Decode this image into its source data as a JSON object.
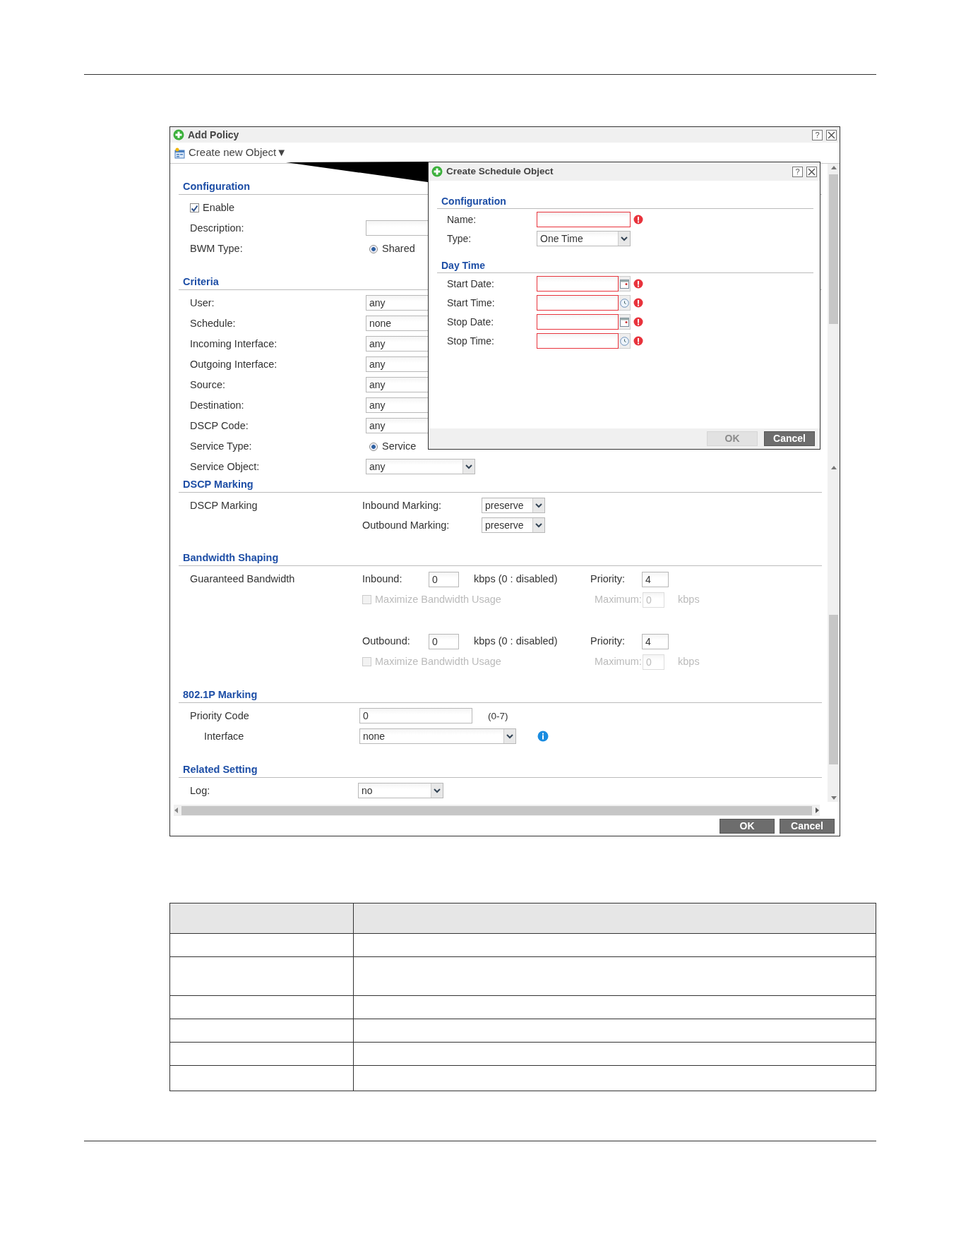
{
  "dialog": {
    "title": "Add Policy",
    "help": "?",
    "toolbar": {
      "label": "Create new Object",
      "caret": "▼"
    },
    "sections": [
      {
        "title": "Configuration",
        "rows": [
          {
            "kind": "checkbox",
            "label": "Enable",
            "checked": true
          },
          {
            "kind": "field",
            "label": "Description:"
          },
          {
            "kind": "radio",
            "label": "BWM Type:",
            "option": "Shared",
            "selected": true
          }
        ]
      },
      {
        "title": "Criteria",
        "rows": [
          {
            "kind": "field",
            "label": "User:",
            "value": "any"
          },
          {
            "kind": "field",
            "label": "Schedule:",
            "value": "none"
          },
          {
            "kind": "field",
            "label": "Incoming Interface:",
            "value": "any"
          },
          {
            "kind": "field",
            "label": "Outgoing Interface:",
            "value": "any"
          },
          {
            "kind": "field",
            "label": "Source:",
            "value": "any"
          },
          {
            "kind": "field",
            "label": "Destination:",
            "value": "any"
          },
          {
            "kind": "field",
            "label": "DSCP Code:",
            "value": "any"
          },
          {
            "kind": "radio",
            "label": "Service Type:",
            "option": "Service",
            "selected": true
          },
          {
            "kind": "select",
            "label": "Service Object:",
            "value": "any"
          }
        ]
      },
      {
        "title": "DSCP Marking",
        "rows": [
          {
            "kind": "marking",
            "label": "DSCP Marking",
            "lines": [
              {
                "label": "Inbound Marking:",
                "value": "preserve"
              },
              {
                "label": "Outbound Marking:",
                "value": "preserve"
              }
            ]
          }
        ]
      },
      {
        "title": "Bandwidth Shaping",
        "rows": [
          {
            "kind": "bandwidth",
            "label": "Guaranteed Bandwidth",
            "directions": [
              {
                "label": "Inbound:",
                "value": "0",
                "unit": "kbps (0 : disabled)",
                "priority_label": "Priority:",
                "priority": "4",
                "maximize": {
                  "label": "Maximize Bandwidth Usage",
                  "checked": false,
                  "disabled": true
                },
                "maximum_label": "Maximum:",
                "maximum": "0",
                "maximum_unit": "kbps"
              },
              {
                "label": "Outbound:",
                "value": "0",
                "unit": "kbps (0 : disabled)",
                "priority_label": "Priority:",
                "priority": "4",
                "maximize": {
                  "label": "Maximize Bandwidth Usage",
                  "checked": false,
                  "disabled": true
                },
                "maximum_label": "Maximum:",
                "maximum": "0",
                "maximum_unit": "kbps"
              }
            ]
          }
        ]
      },
      {
        "title": "802.1P Marking",
        "rows": [
          {
            "kind": "field",
            "label": "Priority Code",
            "value": "0",
            "hint": "(0-7)"
          },
          {
            "kind": "select",
            "label": "Interface",
            "value": "none",
            "indented": true,
            "info": true
          }
        ]
      },
      {
        "title": "Related Setting",
        "rows": [
          {
            "kind": "select",
            "label": "Log:",
            "value": "no"
          }
        ]
      }
    ],
    "buttons": [
      {
        "label": "OK",
        "disabled": false
      },
      {
        "label": "Cancel",
        "disabled": false
      }
    ]
  },
  "schedule_dialog": {
    "title": "Create Schedule Object",
    "help": "?",
    "sections": [
      {
        "title": "Configuration",
        "rows": [
          {
            "kind": "field",
            "label": "Name:",
            "required": true
          },
          {
            "kind": "select",
            "label": "Type:",
            "value": "One Time"
          }
        ]
      },
      {
        "title": "Day Time",
        "rows": [
          {
            "kind": "date",
            "label": "Start Date:",
            "required": true
          },
          {
            "kind": "time",
            "label": "Start Time:",
            "required": true
          },
          {
            "kind": "date",
            "label": "Stop Date:",
            "required": true
          },
          {
            "kind": "time",
            "label": "Stop Time:",
            "required": true
          }
        ]
      }
    ],
    "buttons": [
      {
        "label": "OK",
        "disabled": true
      },
      {
        "label": "Cancel",
        "disabled": false
      }
    ]
  }
}
